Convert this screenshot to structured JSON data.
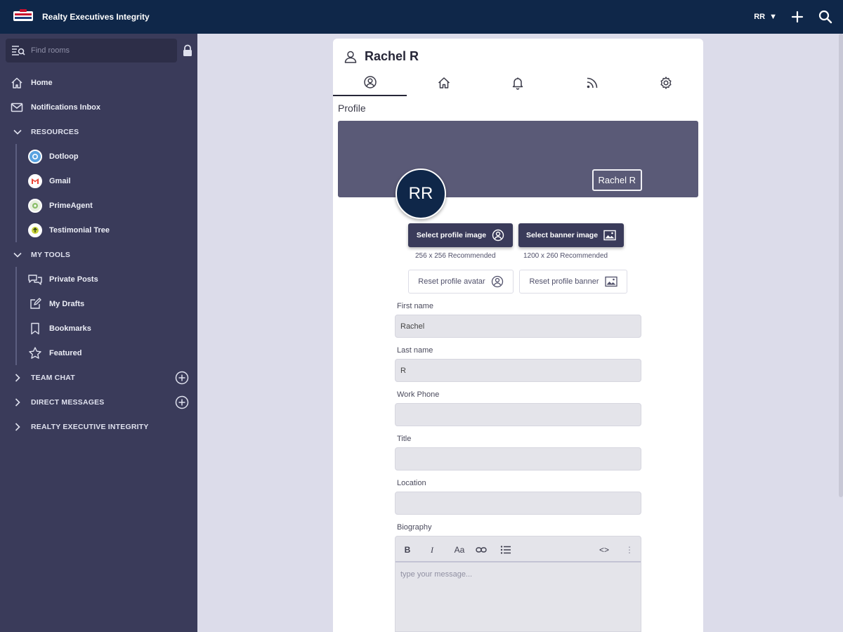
{
  "topbar": {
    "app_title": "Realty Executives Integrity",
    "user_initials": "RR",
    "caret": "▼"
  },
  "sidebar": {
    "search_placeholder": "Find rooms",
    "nav": [
      {
        "label": "Home",
        "icon": "home-icon"
      },
      {
        "label": "Notifications Inbox",
        "icon": "envelope-icon"
      }
    ],
    "resources": {
      "label": "RESOURCES",
      "items": [
        {
          "label": "Dotloop",
          "icon": "dotloop-icon",
          "color": "#5aa3e0"
        },
        {
          "label": "Gmail",
          "icon": "gmail-icon",
          "color": "#ea4335"
        },
        {
          "label": "PrimeAgent",
          "icon": "primeagent-icon",
          "color": "#8cbf6a"
        },
        {
          "label": "Testimonial Tree",
          "icon": "testimonial-tree-icon",
          "color": "#c9d43a"
        }
      ]
    },
    "my_tools": {
      "label": "MY TOOLS",
      "items": [
        {
          "label": "Private Posts",
          "icon": "chat-bubbles-icon"
        },
        {
          "label": "My Drafts",
          "icon": "edit-icon"
        },
        {
          "label": "Bookmarks",
          "icon": "bookmark-icon"
        },
        {
          "label": "Featured",
          "icon": "star-icon"
        }
      ]
    },
    "collapsed_sections": [
      {
        "label": "TEAM CHAT",
        "has_add": true
      },
      {
        "label": "DIRECT MESSAGES",
        "has_add": true
      },
      {
        "label": "REALTY EXECUTIVE INTEGRITY",
        "has_add": false
      }
    ]
  },
  "profile": {
    "name": "Rachel R",
    "section_label": "Profile",
    "banner_name": "Rachel R",
    "avatar_initials": "RR",
    "select_profile_image": "Select profile image",
    "select_banner_image": "Select banner image",
    "profile_recommended": "256 x 256 Recommended",
    "banner_recommended": "1200 x 260 Recommended",
    "reset_avatar": "Reset profile avatar",
    "reset_banner": "Reset profile banner",
    "fields": {
      "first_name": {
        "label": "First name",
        "value": "Rachel"
      },
      "last_name": {
        "label": "Last name",
        "value": "R"
      },
      "work_phone": {
        "label": "Work Phone",
        "value": ""
      },
      "title": {
        "label": "Title",
        "value": ""
      },
      "location": {
        "label": "Location",
        "value": ""
      },
      "biography": {
        "label": "Biography",
        "placeholder": "type your message..."
      }
    },
    "editor_toolbar": {
      "bold": "B",
      "italic": "I",
      "font_size": "Aa",
      "code": "<>",
      "more": "⋮"
    }
  },
  "colors": {
    "topbar": "#0f2749",
    "sidebar": "#3a3b5a",
    "banner": "#5a5a77",
    "background": "#dcdcea"
  }
}
